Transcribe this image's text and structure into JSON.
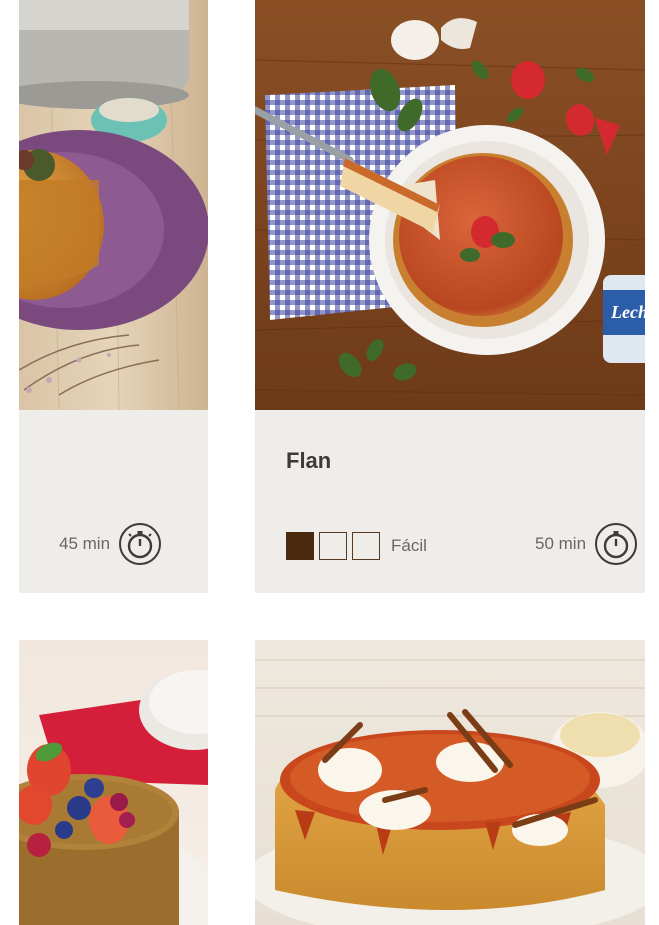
{
  "cards": [
    {
      "id": "left-top",
      "title": "",
      "time": "45 min",
      "difficulty": null
    },
    {
      "id": "flan",
      "title": "Flan",
      "time": "50 min",
      "difficulty": {
        "level": 1,
        "max": 3,
        "label": "Fácil"
      }
    }
  ],
  "brand": {
    "can_label": "Lech"
  },
  "colors": {
    "card_bg": "#efedea",
    "difficulty_fill": "#4a2a0e",
    "text_muted": "#6b6660",
    "title_text": "#3d3a37"
  }
}
